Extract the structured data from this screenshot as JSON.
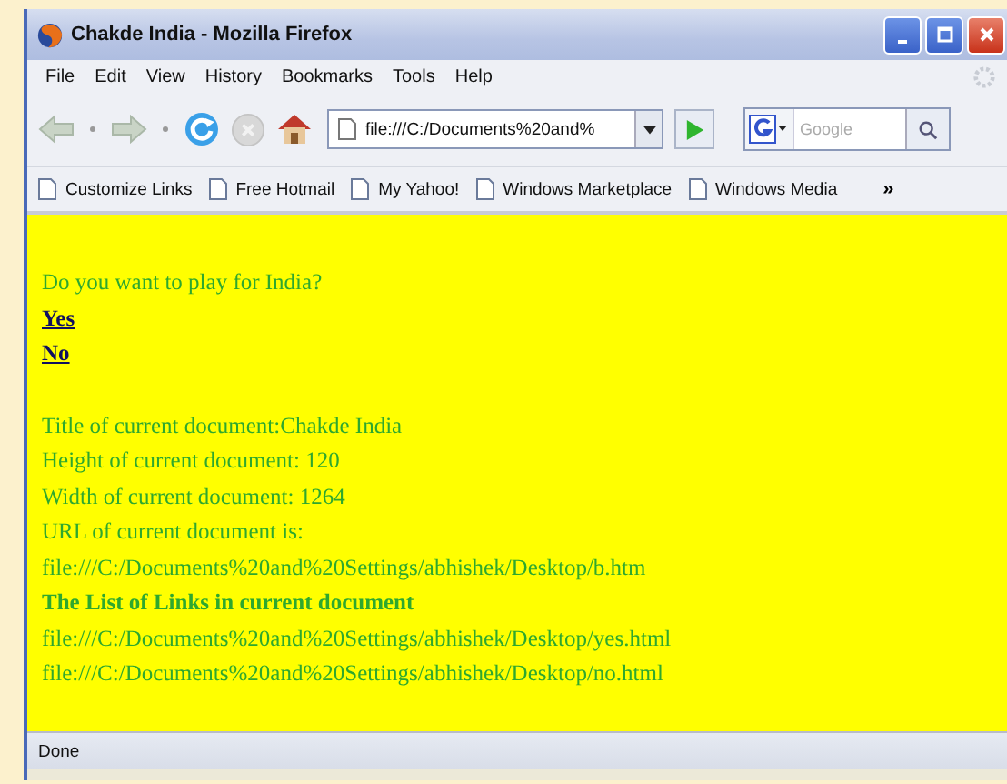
{
  "window": {
    "title": "Chakde India - Mozilla Firefox"
  },
  "menu": [
    "File",
    "Edit",
    "View",
    "History",
    "Bookmarks",
    "Tools",
    "Help"
  ],
  "toolbar": {
    "address": "file:///C:/Documents%20and%",
    "search": {
      "placeholder": "Google"
    }
  },
  "bookmarks": {
    "items": [
      "Customize Links",
      "Free Hotmail",
      "My Yahoo!",
      "Windows Marketplace",
      "Windows Media"
    ],
    "overflow": "»"
  },
  "page": {
    "question": "Do you want to play for India?",
    "answer_links": [
      "Yes",
      "No"
    ],
    "document_info": [
      "Title of current document:Chakde India",
      "Height of current document: 120",
      "Width of current document: 1264",
      "URL of current document is:",
      "file:///C:/Documents%20and%20Settings/abhishek/Desktop/b.htm"
    ],
    "links_heading": "The List of Links in current document",
    "link_urls": [
      "file:///C:/Documents%20and%20Settings/abhishek/Desktop/yes.html",
      "file:///C:/Documents%20and%20Settings/abhishek/Desktop/no.html"
    ]
  },
  "status_bar": "Done"
}
